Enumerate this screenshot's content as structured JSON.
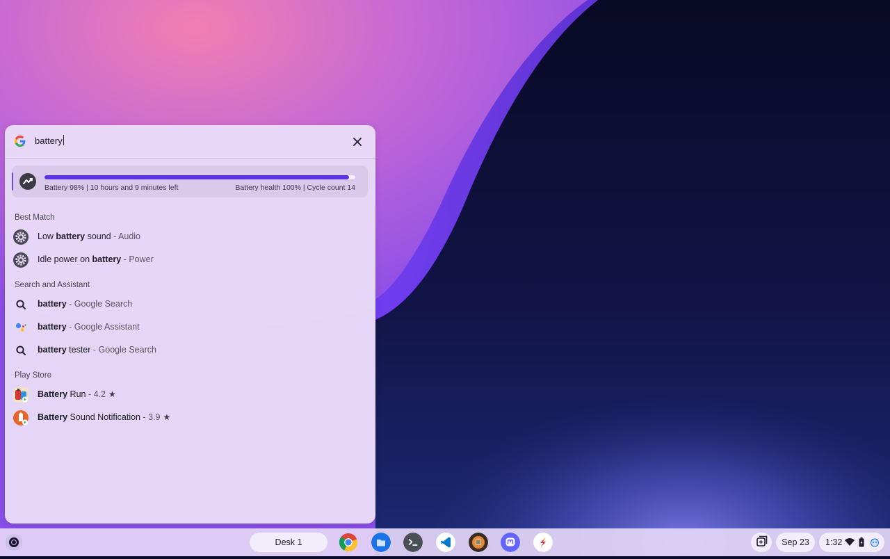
{
  "search": {
    "query": "battery"
  },
  "battery": {
    "level_fraction": 0.98,
    "status_left": "Battery 98% | 10 hours and 9 minutes left",
    "status_right": "Battery health 100% | Cycle count 14"
  },
  "sections": {
    "best_match": "Best Match",
    "search_assistant": "Search and Assistant",
    "play_store": "Play Store"
  },
  "best_match": [
    {
      "pre": "Low ",
      "bold": "battery",
      "post": " sound",
      "suffix": " - Audio",
      "icon": "settings-gear-icon"
    },
    {
      "pre": "Idle power on ",
      "bold": "battery",
      "post": "",
      "suffix": " - Power",
      "icon": "settings-gear-icon"
    }
  ],
  "search_assistant": [
    {
      "bold": "battery",
      "post": "",
      "suffix": " - Google Search",
      "icon": "search-icon"
    },
    {
      "bold": "battery",
      "post": "",
      "suffix": " - Google Assistant",
      "icon": "google-assistant-icon"
    },
    {
      "bold": "battery",
      "post": " tester",
      "suffix": " - Google Search",
      "icon": "search-icon"
    }
  ],
  "play_store": [
    {
      "bold": "Battery",
      "post": " Run",
      "suffix": " - 4.2",
      "icon": "battery-run-app-icon"
    },
    {
      "bold": "Battery",
      "post": " Sound Notification",
      "suffix": " - 3.9",
      "icon": "battery-sound-app-icon"
    }
  ],
  "shelf": {
    "desk_label": "Desk 1",
    "date": "Sep 23",
    "time": "1:32",
    "apps": [
      "chrome-icon",
      "files-icon",
      "terminal-icon",
      "vscode-icon",
      "app-icon",
      "mastodon-icon",
      "app-icon"
    ]
  },
  "colors": {
    "accent": "#5b33e0",
    "panel": "#e9dcf8"
  }
}
